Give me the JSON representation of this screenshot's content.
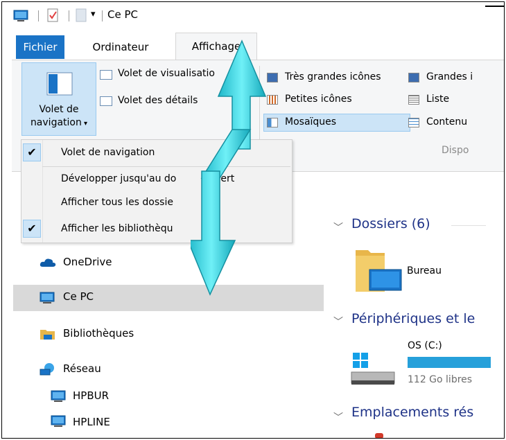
{
  "window": {
    "title": "Ce PC"
  },
  "tabs": [
    {
      "label": "Fichier"
    },
    {
      "label": "Ordinateur"
    },
    {
      "label": "Affichage"
    }
  ],
  "ribbon": {
    "volet_navigation_label_1": "Volet de",
    "volet_navigation_label_2": "navigation",
    "volet_visualisation": "Volet de visualisatio",
    "volet_details": "Volet des détails",
    "layout": {
      "tres_grandes": "Très grandes icônes",
      "grandes": "Grandes i",
      "petites": "Petites icônes",
      "liste": "Liste",
      "mosaiques": "Mosaïques",
      "contenu": "Contenu"
    },
    "group_label": "Dispo"
  },
  "menu": {
    "items": [
      {
        "label": "Volet de navigation",
        "checked": true
      },
      {
        "label": "Développer jusqu'au dossier ouvert",
        "visible_part": "Développer jusqu'au do",
        "tail": "ert",
        "checked": false
      },
      {
        "label": "Afficher tous les dossie",
        "checked": false
      },
      {
        "label": "Afficher les bibliothèqu",
        "checked": true
      }
    ],
    "check_glyph": "✔"
  },
  "nav": {
    "items": [
      {
        "label": "OneDrive",
        "icon": "cloud-icon"
      },
      {
        "label": "Ce PC",
        "icon": "computer-icon",
        "selected": true
      },
      {
        "label": "Bibliothèques",
        "icon": "library-icon"
      },
      {
        "label": "Réseau",
        "icon": "network-icon"
      },
      {
        "label": "HPBUR",
        "icon": "computer-icon"
      },
      {
        "label": "HPLINE",
        "icon": "computer-icon"
      }
    ]
  },
  "content": {
    "groups": [
      {
        "title": "Dossiers (6)"
      },
      {
        "title": "Périphériques et le"
      },
      {
        "title": "Emplacements rés"
      }
    ],
    "folder": {
      "label": "Bureau"
    },
    "drive": {
      "label": "OS (C:)",
      "free": "112 Go libres"
    }
  },
  "colors": {
    "accent": "#1a73c6",
    "selection": "#cce4f7",
    "arrow": "#3fd6e6",
    "drive_bar": "#26a0da"
  }
}
